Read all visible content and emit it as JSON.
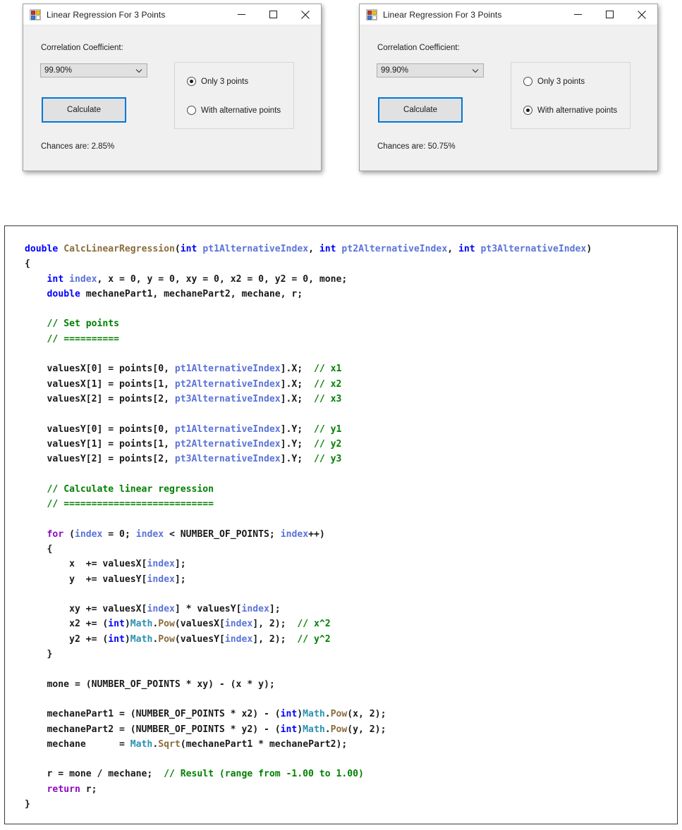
{
  "windows": [
    {
      "title": "Linear Regression For 3 Points",
      "icon": "winforms-app-icon",
      "caption": {
        "minimize": "minimize-icon",
        "maximize": "maximize-icon",
        "close": "close-icon"
      },
      "correlation_label": "Correlation Coefficient:",
      "correlation_value": "99.90%",
      "calculate_label": "Calculate",
      "result_label": "Chances are: 2.85%",
      "options": [
        {
          "label": "Only 3 points",
          "selected": true
        },
        {
          "label": "With alternative points",
          "selected": false
        }
      ]
    },
    {
      "title": "Linear Regression For 3 Points",
      "icon": "winforms-app-icon",
      "caption": {
        "minimize": "minimize-icon",
        "maximize": "maximize-icon",
        "close": "close-icon"
      },
      "correlation_label": "Correlation Coefficient:",
      "correlation_value": "99.90%",
      "calculate_label": "Calculate",
      "result_label": "Chances are: 50.75%",
      "options": [
        {
          "label": "Only 3 points",
          "selected": false
        },
        {
          "label": "With alternative points",
          "selected": true
        }
      ]
    }
  ],
  "colors": {
    "accent_focus": "#0078d7",
    "window_bg": "#f0f0f0",
    "control_bg": "#e1e1e1",
    "keyword": "#0000ff",
    "control_keyword": "#8f08c4",
    "comment": "#008000",
    "class_name": "#2b91af",
    "method_name": "#8a6d3b",
    "parameter": "#5b73d8"
  },
  "code": {
    "language": "C#",
    "text": "double CalcLinearRegression(int pt1AlternativeIndex, int pt2AlternativeIndex, int pt3AlternativeIndex)\n{\n    int index, x = 0, y = 0, xy = 0, x2 = 0, y2 = 0, mone;\n    double mechanePart1, mechanePart2, mechane, r;\n\n    // Set points\n    // ==========\n\n    valuesX[0] = points[0, pt1AlternativeIndex].X;  // x1\n    valuesX[1] = points[1, pt2AlternativeIndex].X;  // x2\n    valuesX[2] = points[2, pt3AlternativeIndex].X;  // x3\n\n    valuesY[0] = points[0, pt1AlternativeIndex].Y;  // y1\n    valuesY[1] = points[1, pt2AlternativeIndex].Y;  // y2\n    valuesY[2] = points[2, pt3AlternativeIndex].Y;  // y3\n\n    // Calculate linear regression\n    // ===========================\n\n    for (index = 0; index < NUMBER_OF_POINTS; index++)\n    {\n        x  += valuesX[index];\n        y  += valuesY[index];\n\n        xy += valuesX[index] * valuesY[index];\n        x2 += (int)Math.Pow(valuesX[index], 2);  // x^2\n        y2 += (int)Math.Pow(valuesY[index], 2);  // y^2\n    }\n\n    mone = (NUMBER_OF_POINTS * xy) - (x * y);\n\n    mechanePart1 = (NUMBER_OF_POINTS * x2) - (int)Math.Pow(x, 2);\n    mechanePart2 = (NUMBER_OF_POINTS * y2) - (int)Math.Pow(y, 2);\n    mechane      = Math.Sqrt(mechanePart1 * mechanePart2);\n\n    r = mone / mechane;  // Result (range from -1.00 to 1.00)\n    return r;\n}",
    "tokens": {
      "keywords": [
        "double",
        "int"
      ],
      "control_keywords": [
        "for",
        "return"
      ],
      "classes": [
        "Math"
      ],
      "methods": [
        "CalcLinearRegression",
        "Pow",
        "Sqrt"
      ],
      "parameters": [
        "pt1AlternativeIndex",
        "pt2AlternativeIndex",
        "pt3AlternativeIndex",
        "index"
      ],
      "comments": [
        "// Set points",
        "// ==========",
        "// x1",
        "// x2",
        "// x3",
        "// y1",
        "// y2",
        "// y3",
        "// Calculate linear regression",
        "// ===========================",
        "// x^2",
        "// y^2",
        "// Result (range from -1.00 to 1.00)"
      ]
    }
  }
}
